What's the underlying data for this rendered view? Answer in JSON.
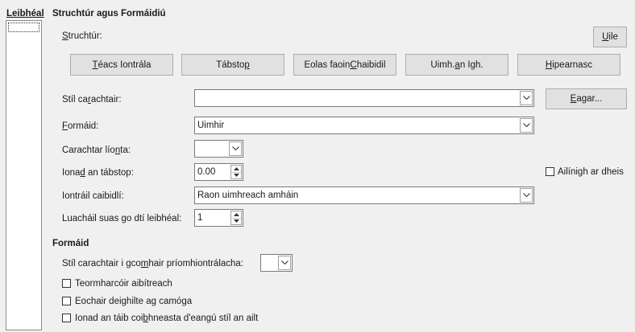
{
  "levels": {
    "title": "Leibhéal"
  },
  "structure_section": {
    "title": "Struchtúr agus Formáidiú",
    "structure_label": "Struchtúr:",
    "all_button": "Uile",
    "buttons": [
      "Téacs Iontrála",
      "Tábstop",
      "Eolas faoin Chaibidil",
      "Uimh. an Igh.",
      "Hipearnasc"
    ]
  },
  "fields": {
    "char_style_label": "Stíl carachtair:",
    "char_style_value": "",
    "edit_button": "Eagar...",
    "format_label": "Formáid:",
    "format_value": "Uimhir",
    "fill_char_label": "Carachtar líonta:",
    "fill_char_value": "",
    "tab_pos_label": "Ionad an tábstop:",
    "tab_pos_value": "0.00",
    "align_right_label": "Ailínigh ar dheis",
    "chapter_entry_label": "Iontráil caibidlí:",
    "chapter_entry_value": "Raon uimhreach amháin",
    "eval_level_label": "Luacháil suas go dtí leibhéal:",
    "eval_level_value": "1"
  },
  "format_section": {
    "title": "Formáid",
    "main_entry_style_label": "Stíl carachtair i gcomhair príomhiontrálacha:",
    "main_entry_style_value": "",
    "options": [
      {
        "label": "Teormharcóir aibítreach",
        "checked": false
      },
      {
        "label": "Eochair deighilte ag camóga",
        "checked": false
      },
      {
        "label": "Ionad an táib coibhneasta d'eangú stíl an ailt",
        "checked": false
      }
    ]
  },
  "colors": {
    "background": "#f0f0f0",
    "button": "#e1e1e1",
    "border": "#adadad"
  }
}
